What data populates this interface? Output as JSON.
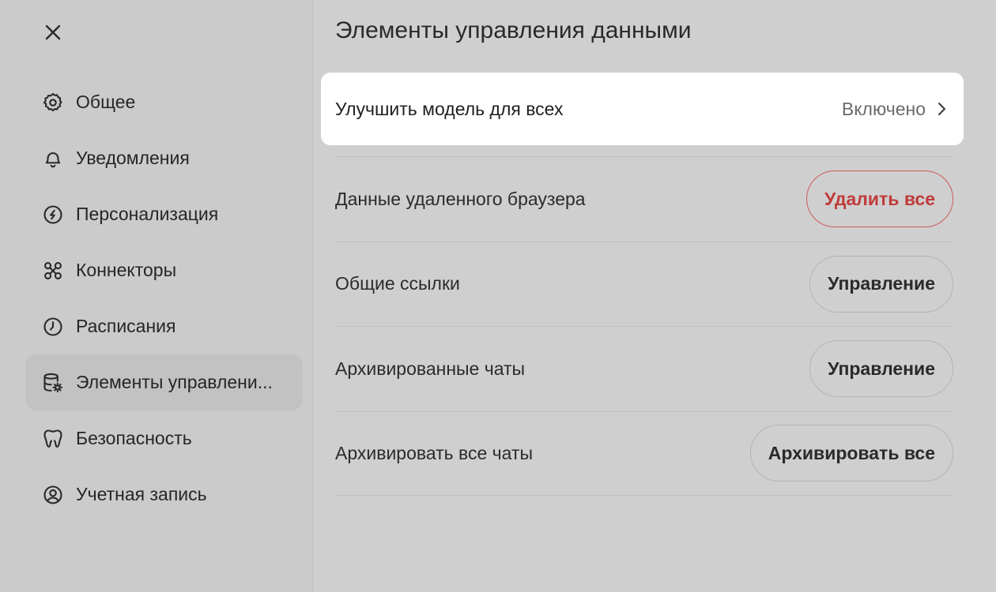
{
  "sidebar": {
    "items": [
      {
        "label": "Общее",
        "icon": "gear-icon",
        "active": false
      },
      {
        "label": "Уведомления",
        "icon": "bell-icon",
        "active": false
      },
      {
        "label": "Персонализация",
        "icon": "personalization-icon",
        "active": false
      },
      {
        "label": "Коннекторы",
        "icon": "connectors-icon",
        "active": false
      },
      {
        "label": "Расписания",
        "icon": "clock-icon",
        "active": false
      },
      {
        "label": "Элементы управлени...",
        "icon": "database-gear-icon",
        "active": true
      },
      {
        "label": "Безопасность",
        "icon": "shield-icon",
        "active": false
      },
      {
        "label": "Учетная запись",
        "icon": "user-circle-icon",
        "active": false
      }
    ]
  },
  "main": {
    "title": "Элементы управления данными",
    "highlight": {
      "label": "Улучшить модель для всех",
      "value": "Включено"
    },
    "rows": [
      {
        "label": "Данные удаленного браузера",
        "button": "Удалить все",
        "danger": true
      },
      {
        "label": "Общие ссылки",
        "button": "Управление",
        "danger": false
      },
      {
        "label": "Архивированные чаты",
        "button": "Управление",
        "danger": false
      },
      {
        "label": "Архивировать все чаты",
        "button": "Архивировать все",
        "danger": false
      }
    ]
  },
  "colors": {
    "danger": "#c13a3a",
    "background": "#cfcfcf",
    "card": "#ffffff"
  }
}
